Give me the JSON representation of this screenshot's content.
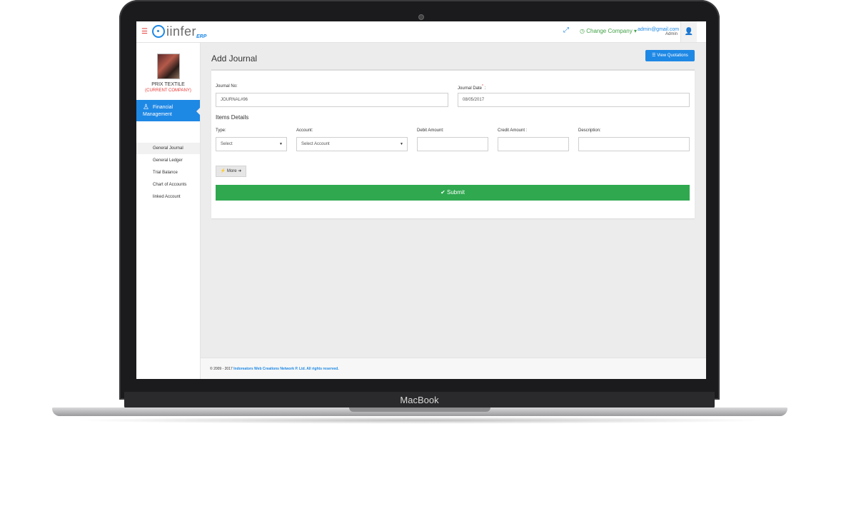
{
  "device": {
    "brand": "MacBook"
  },
  "app": {
    "logo_text": "iinfer",
    "logo_suffix": "ERP",
    "change_company": "Change Company",
    "user_email": "admin@gmail.com",
    "user_role": "Admin"
  },
  "sidebar": {
    "company_name": "PRIX TEXTILE",
    "company_tag": "(CURRENT COMPANY)",
    "section": "Financial Management",
    "items": [
      {
        "label": "General Journal",
        "active": true
      },
      {
        "label": "General Ledger"
      },
      {
        "label": "Trial Balance"
      },
      {
        "label": "Chart of Accounts"
      },
      {
        "label": "linked Account"
      }
    ]
  },
  "page": {
    "title": "Add Journal",
    "view_quotations": "View Quotations"
  },
  "form": {
    "journal_no_label": "Journal No:",
    "journal_no_value": "JOURNAL#96",
    "journal_date_label": "Journal Date",
    "journal_date_required": "*",
    "journal_date_colon": ":",
    "journal_date_value": "08/05/2017",
    "items_title": "Items Details",
    "type_label": "Type:",
    "type_value": "Select",
    "account_label": "Account:",
    "account_value": "Select Account",
    "debit_label": "Debit Amount:",
    "credit_label": "Credit Amount :",
    "description_label": "Description:",
    "more_label": "More",
    "submit_label": "Submit"
  },
  "footer": {
    "copyright": "© 2009 - 2017",
    "company_link": "Indoreators Web Creations Network P. Ltd. All rights reserved."
  },
  "colors": {
    "primary": "#1e88e5",
    "success": "#2fa84f",
    "danger": "#e53935"
  }
}
